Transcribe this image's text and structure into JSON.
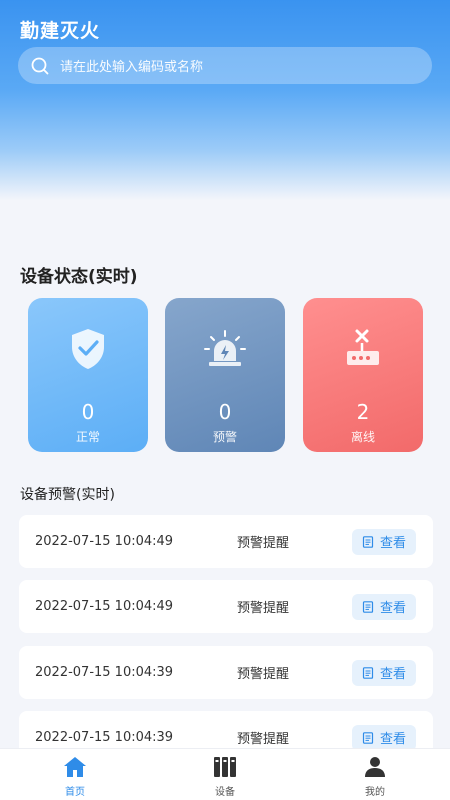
{
  "app": {
    "title": "勤建灭火"
  },
  "search": {
    "placeholder": "请在此处输入编码或名称"
  },
  "status": {
    "title": "设备状态(实时)",
    "cards": [
      {
        "count": "0",
        "label": "正常",
        "icon": "shield-check-icon",
        "color": "#5caef6"
      },
      {
        "count": "0",
        "label": "预警",
        "icon": "alarm-light-icon",
        "color": "#5f86b6"
      },
      {
        "count": "2",
        "label": "离线",
        "icon": "offline-router-icon",
        "color": "#f26a6a"
      }
    ]
  },
  "alerts": {
    "title": "设备预警(实时)",
    "view_label": "查看",
    "rows": [
      {
        "time": "2022-07-15 10:04:49",
        "type": "预警提醒"
      },
      {
        "time": "2022-07-15 10:04:49",
        "type": "预警提醒"
      },
      {
        "time": "2022-07-15 10:04:39",
        "type": "预警提醒"
      },
      {
        "time": "2022-07-15 10:04:39",
        "type": "预警提醒"
      }
    ]
  },
  "tabbar": {
    "items": [
      {
        "label": "首页",
        "icon": "home-icon",
        "active": true
      },
      {
        "label": "设备",
        "icon": "devices-icon",
        "active": false
      },
      {
        "label": "我的",
        "icon": "user-icon",
        "active": false
      }
    ]
  },
  "colors": {
    "accent": "#2f8ce8",
    "header": "#3a93f0"
  }
}
